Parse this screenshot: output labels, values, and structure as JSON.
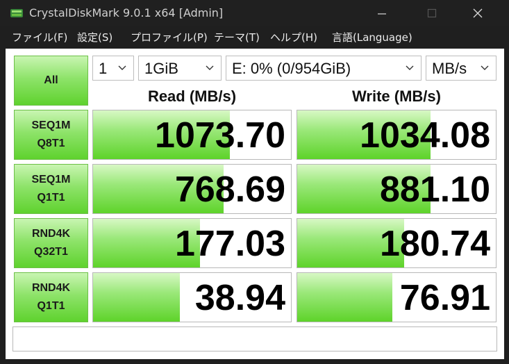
{
  "window": {
    "title": "CrystalDiskMark 9.0.1 x64 [Admin]"
  },
  "menu": [
    {
      "label": "ファイル(F)"
    },
    {
      "label": "設定(S)"
    },
    {
      "label": "プロファイル(P)"
    },
    {
      "label": "テーマ(T)"
    },
    {
      "label": "ヘルプ(H)"
    },
    {
      "label": "言語(Language)"
    }
  ],
  "controls": {
    "all_label": "All",
    "count": "1",
    "size": "1GiB",
    "drive": "E: 0% (0/954GiB)",
    "unit": "MB/s"
  },
  "headers": {
    "read": "Read (MB/s)",
    "write": "Write (MB/s)"
  },
  "tests": [
    {
      "line1": "SEQ1M",
      "line2": "Q8T1",
      "read": "1073.70",
      "write": "1034.08",
      "read_fill": 0.69,
      "write_fill": 0.67
    },
    {
      "line1": "SEQ1M",
      "line2": "Q1T1",
      "read": "768.69",
      "write": "881.10",
      "read_fill": 0.66,
      "write_fill": 0.67
    },
    {
      "line1": "RND4K",
      "line2": "Q32T1",
      "read": "177.03",
      "write": "180.74",
      "read_fill": 0.54,
      "write_fill": 0.54
    },
    {
      "line1": "RND4K",
      "line2": "Q1T1",
      "read": "38.94",
      "write": "76.91",
      "read_fill": 0.44,
      "write_fill": 0.48
    }
  ],
  "status": "",
  "colors": {
    "bar_green": "#5ed32a",
    "titlebar": "#202020"
  }
}
